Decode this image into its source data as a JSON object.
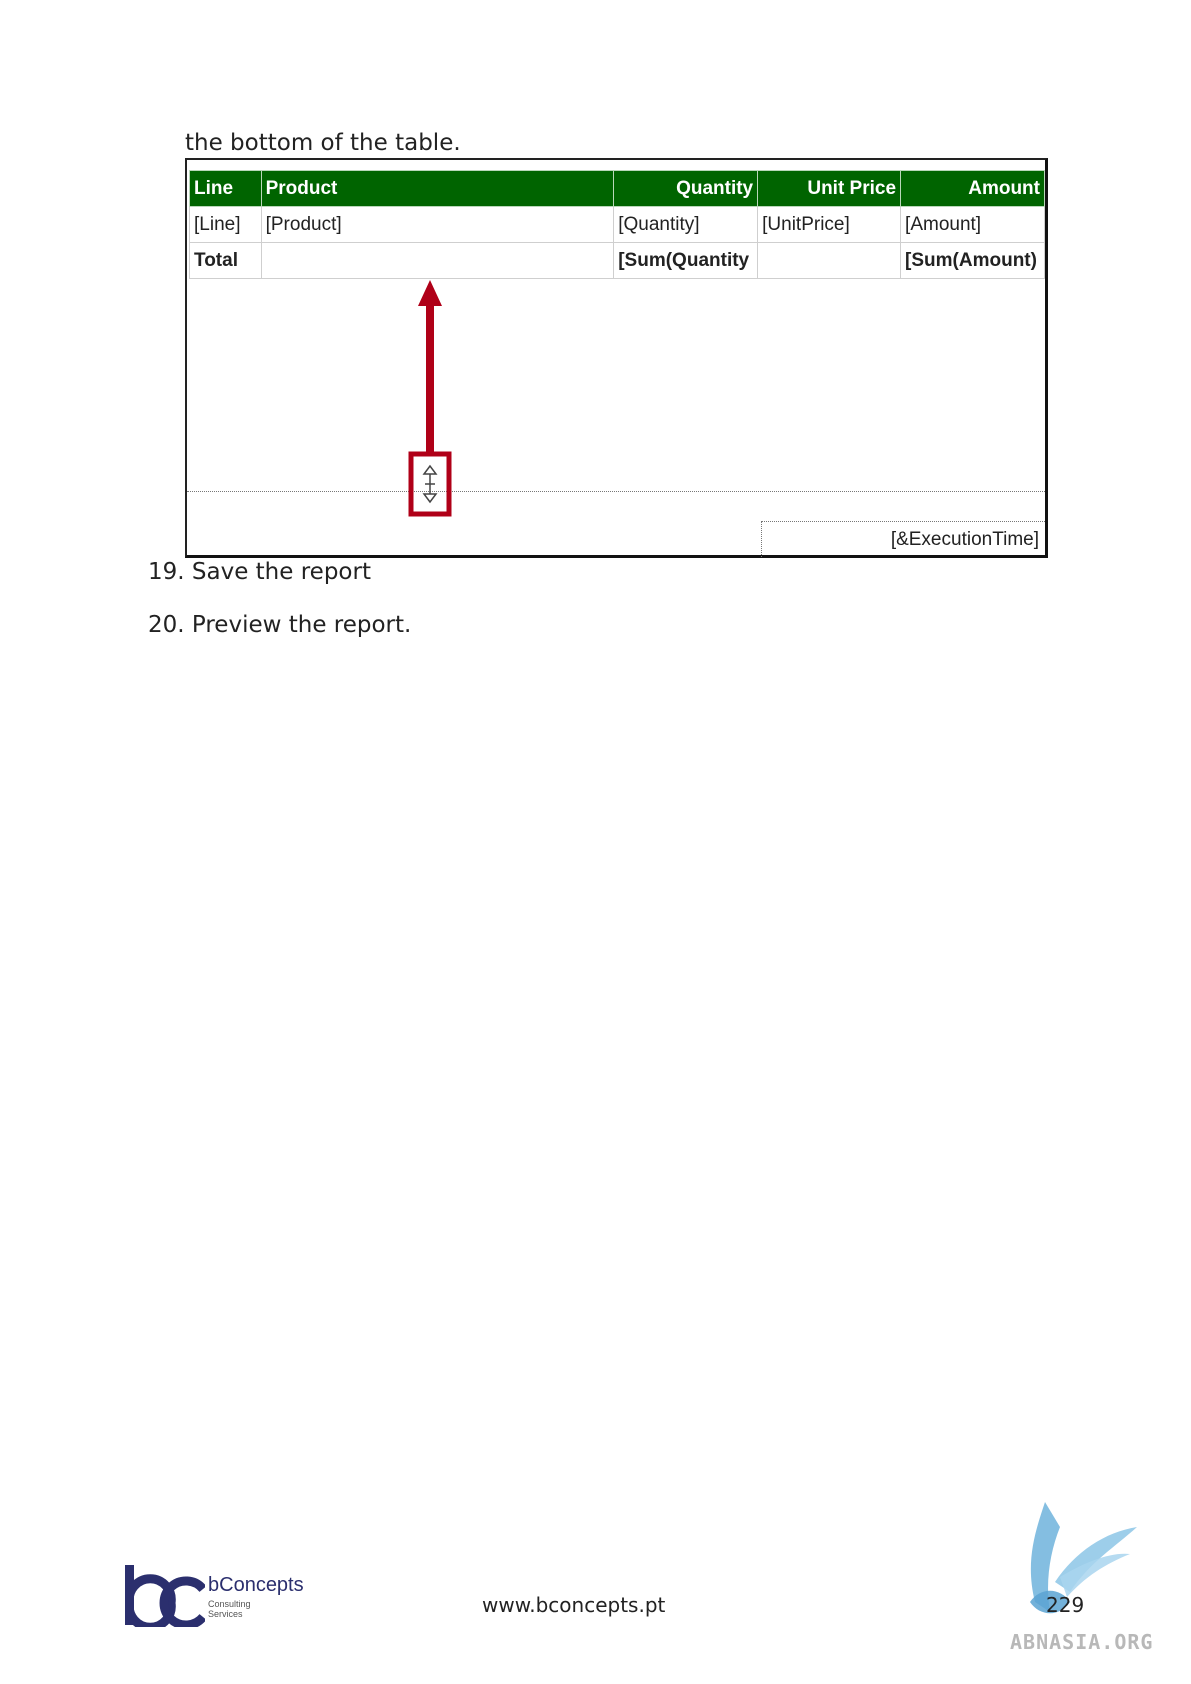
{
  "intro_text": "the bottom of the table.",
  "report": {
    "headers": [
      "Line",
      "Product",
      "Quantity",
      "Unit Price",
      "Amount"
    ],
    "detail_row": [
      "[Line]",
      "[Product]",
      "[Quantity]",
      "[UnitPrice]",
      "[Amount]"
    ],
    "total_row": [
      "Total",
      "",
      "[Sum(Quantity",
      "",
      "[Sum(Amount)"
    ],
    "execution_time": "[&ExecutionTime]",
    "header_color": "#006400",
    "arrow_color": "#b00018"
  },
  "steps": [
    "19. Save the report",
    "20. Preview the report."
  ],
  "footer": {
    "brand_name": "bConcepts",
    "brand_sub": "Consulting Services",
    "url": "www.bconcepts.pt",
    "page_number": "229",
    "watermark": "ABNASIA.ORG"
  }
}
